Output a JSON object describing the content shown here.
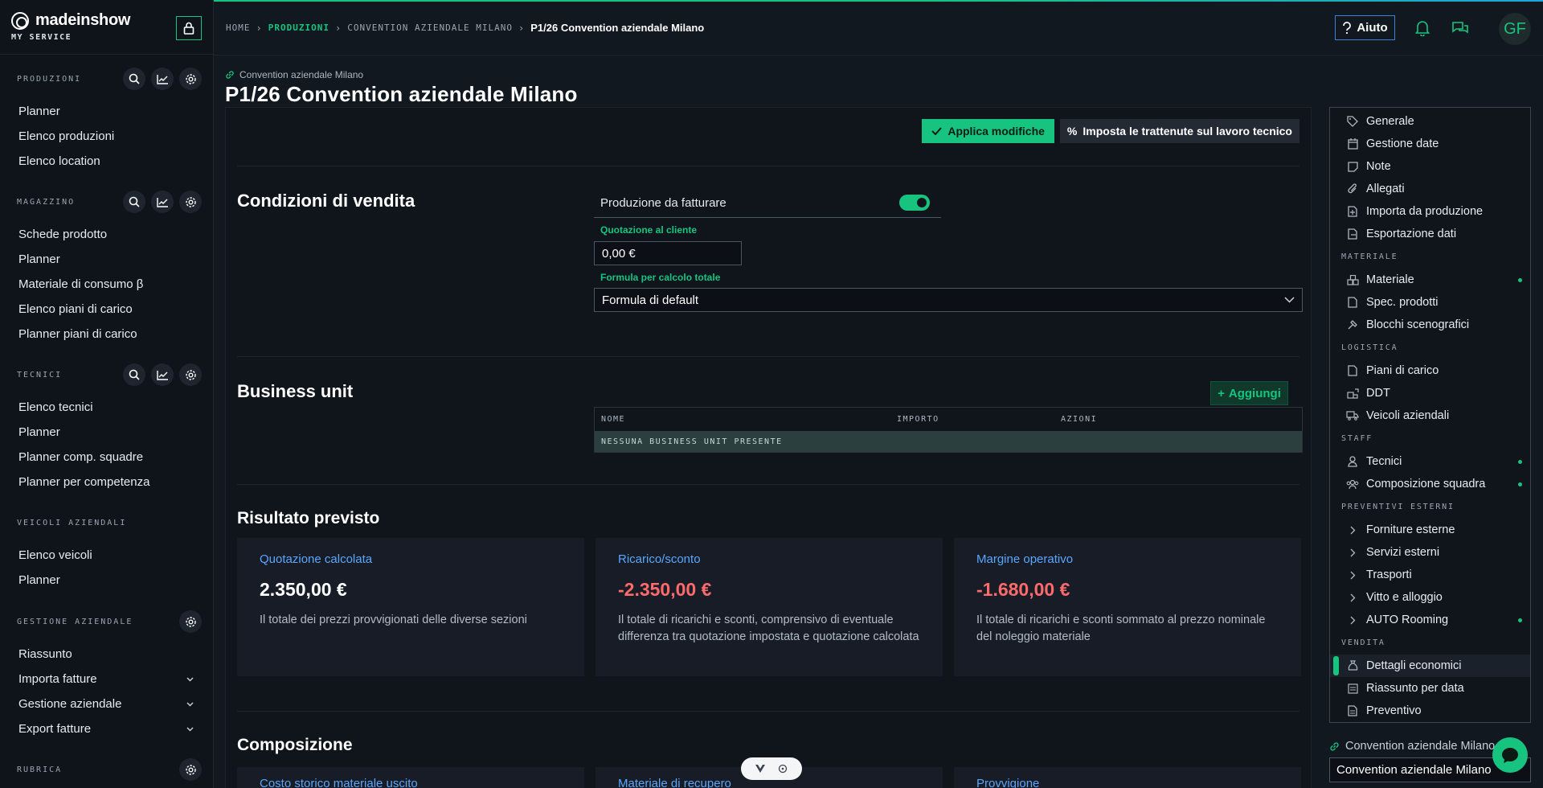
{
  "brand": {
    "name": "madeinshow",
    "subtitle": "MY SERVICE"
  },
  "sidebar": {
    "sections": [
      {
        "title": "PRODUZIONI",
        "tools": [
          "search-icon",
          "chart-icon",
          "gear-icon"
        ],
        "items": [
          "Planner",
          "Elenco produzioni",
          "Elenco location"
        ]
      },
      {
        "title": "MAGAZZINO",
        "tools": [
          "search-icon",
          "chart-icon",
          "gear-icon"
        ],
        "items": [
          "Schede prodotto",
          "Planner",
          "Materiale di consumo β",
          "Elenco piani di carico",
          "Planner piani di carico"
        ]
      },
      {
        "title": "TECNICI",
        "tools": [
          "search-icon",
          "chart-icon",
          "gear-icon"
        ],
        "items": [
          "Elenco tecnici",
          "Planner",
          "Planner comp. squadre",
          "Planner per competenza"
        ]
      },
      {
        "title": "VEICOLI AZIENDALI",
        "tools": [],
        "items": [
          "Elenco veicoli",
          "Planner"
        ]
      },
      {
        "title": "GESTIONE AZIENDALE",
        "tools": [
          "gear-icon"
        ],
        "items": [
          "Riassunto",
          "Importa fatture",
          "Gestione aziendale",
          "Export fatture"
        ]
      },
      {
        "title": "RUBRICA",
        "tools": [
          "gear-icon"
        ],
        "items": []
      }
    ]
  },
  "breadcrumb": {
    "home": "HOME",
    "produzioni": "PRODUZIONI",
    "convention": "CONVENTION AZIENDALE MILANO",
    "current": "P1/26 Convention aziendale Milano"
  },
  "topbar": {
    "help_label": "Aiuto",
    "avatar_initials": "GF"
  },
  "page": {
    "subtitle": "Convention aziendale Milano",
    "title": "P1/26 Convention aziendale Milano"
  },
  "actions": {
    "apply": "Applica modifiche",
    "withholding": "Imposta le trattenute sul lavoro tecnico"
  },
  "sales_conditions": {
    "heading": "Condizioni di vendita",
    "toggle_label": "Produzione da fatturare",
    "toggle_on": true,
    "quote_label": "Quotazione al cliente",
    "quote_value": "0,00 €",
    "formula_label": "Formula per calcolo totale",
    "formula_value": "Formula di default"
  },
  "business_unit": {
    "heading": "Business unit",
    "add_label": "Aggiungi",
    "columns": [
      "NOME",
      "IMPORTO",
      "AZIONI"
    ],
    "empty": "NESSUNA BUSINESS UNIT PRESENTE"
  },
  "expected_result": {
    "heading": "Risultato previsto",
    "cards": [
      {
        "title": "Quotazione calcolata",
        "value": "2.350,00 €",
        "negative": false,
        "desc": "Il totale dei prezzi provvigionati delle diverse sezioni"
      },
      {
        "title": "Ricarico/sconto",
        "value": "-2.350,00 €",
        "negative": true,
        "desc": "Il totale di ricarichi e sconti, comprensivo di eventuale differenza tra quotazione impostata e quotazione calcolata"
      },
      {
        "title": "Margine operativo",
        "value": "-1.680,00 €",
        "negative": true,
        "desc": "Il totale di ricarichi e sconti sommato al prezzo nominale del noleggio materiale"
      }
    ]
  },
  "composition": {
    "heading": "Composizione",
    "cards": [
      "Costo storico materiale uscito",
      "Materiale di recupero",
      "Provvigione"
    ]
  },
  "rightnav": {
    "general": [
      "Generale",
      "Gestione date",
      "Note",
      "Allegati",
      "Importa da produzione",
      "Esportazione dati"
    ],
    "materiale_head": "MATERIALE",
    "materiale": [
      "Materiale",
      "Spec. prodotti",
      "Blocchi scenografici"
    ],
    "logistica_head": "LOGISTICA",
    "logistica": [
      "Piani di carico",
      "DDT",
      "Veicoli aziendali"
    ],
    "staff_head": "STAFF",
    "staff": [
      "Tecnici",
      "Composizione squadra"
    ],
    "preventivi_head": "PREVENTIVI ESTERNI",
    "preventivi": [
      "Forniture esterne",
      "Servizi esterni",
      "Trasporti",
      "Vitto e alloggio",
      "AUTO Rooming"
    ],
    "vendita_head": "VENDITA",
    "vendita": [
      "Dettagli economici",
      "Riassunto per data",
      "Preventivo"
    ],
    "sub_link": "Convention aziendale Milano",
    "sub_input": "Convention aziendale Milano"
  },
  "colors": {
    "accent": "#16c47f",
    "link": "#5aa7ff",
    "negative": "#ff6b6b",
    "bg": "#121820"
  }
}
